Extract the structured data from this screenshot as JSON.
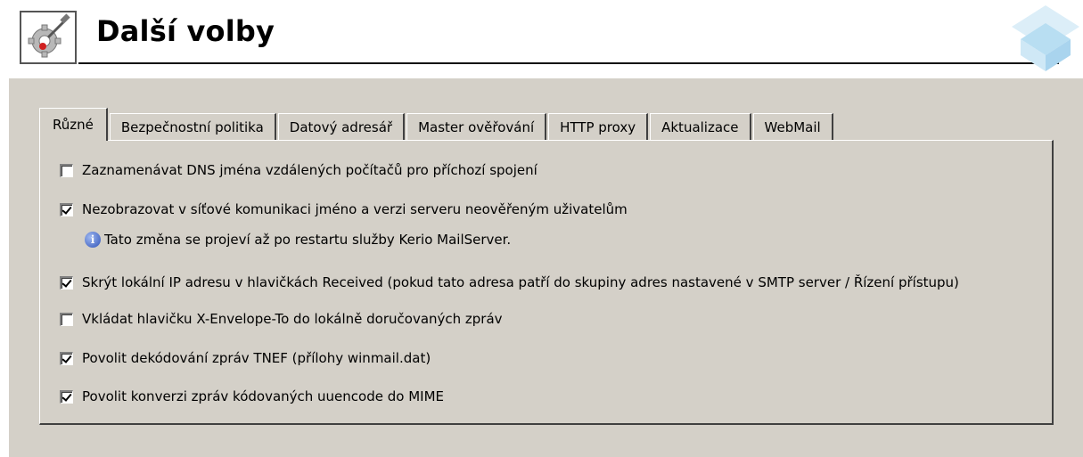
{
  "header": {
    "title": "Další volby",
    "icon": "tools-gear-icon",
    "brand_icon": "kerio-logo-icon"
  },
  "tabs": [
    {
      "label": "Různé",
      "active": true
    },
    {
      "label": "Bezpečnostní politika",
      "active": false
    },
    {
      "label": "Datový adresář",
      "active": false
    },
    {
      "label": "Master ověřování",
      "active": false
    },
    {
      "label": "HTTP proxy",
      "active": false
    },
    {
      "label": "Aktualizace",
      "active": false
    },
    {
      "label": "WebMail",
      "active": false
    }
  ],
  "options": [
    {
      "label": "Zaznamenávat DNS jména vzdálených počítačů pro příchozí spojení",
      "checked": false
    },
    {
      "label": "Nezobrazovat v síťové komunikaci jméno a verzi serveru neověřeným uživatelům",
      "checked": true
    },
    {
      "label": "Skrýt lokální IP adresu v hlavičkách Received (pokud tato adresa patří do skupiny adres nastavené v SMTP server / Řízení přístupu)",
      "checked": true
    },
    {
      "label": "Vkládat hlavičku X-Envelope-To do lokálně doručovaných zpráv",
      "checked": false
    },
    {
      "label": "Povolit dekódování zpráv TNEF (přílohy winmail.dat)",
      "checked": true
    },
    {
      "label": "Povolit konverzi zpráv kódovaných uuencode do MIME",
      "checked": true
    }
  ],
  "note": {
    "icon": "info-icon",
    "text": "Tato změna se projeví až po restartu služby Kerio MailServer."
  }
}
